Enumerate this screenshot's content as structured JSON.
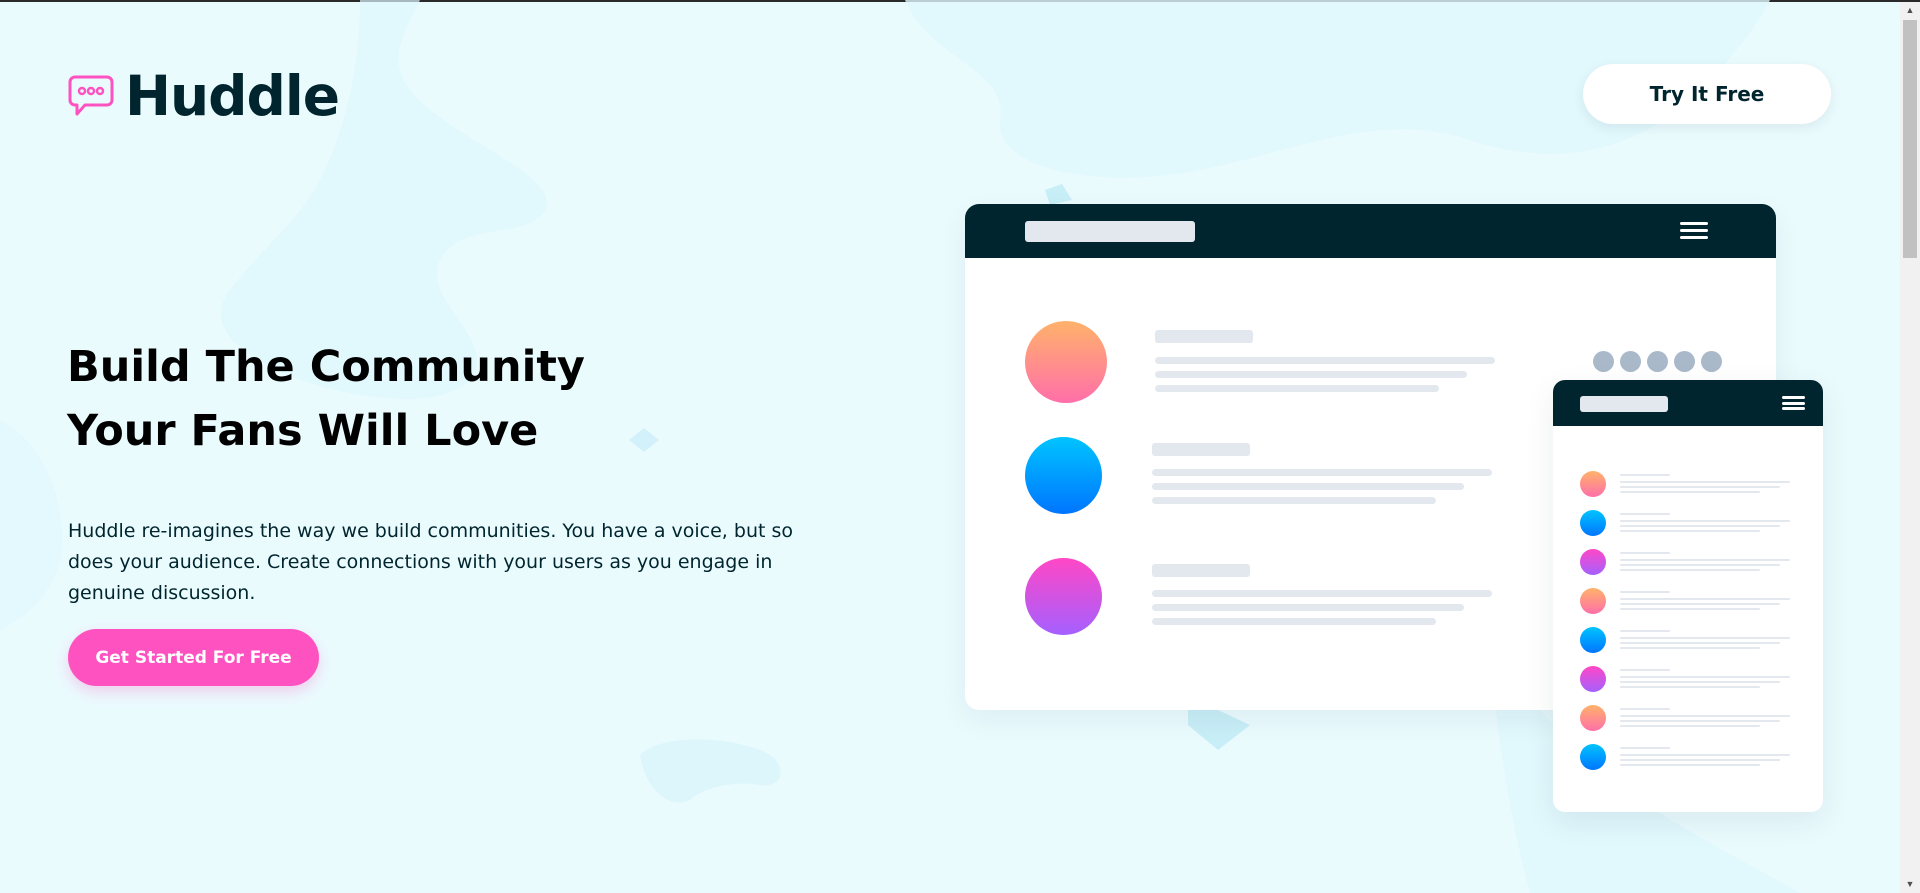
{
  "brand": {
    "name": "Huddle",
    "logo_icon": "chat-bubble-icon"
  },
  "header": {
    "cta_label": "Try It Free"
  },
  "hero": {
    "headline_lines": [
      "Build The Community",
      "Your Fans Will Love"
    ],
    "body_lines": [
      "Huddle re-imagines the way we build communities. You have a voice, but so",
      "does your audience. Create connections with your users as you engage in",
      "genuine discussion."
    ],
    "cta_label": "Get Started For Free"
  },
  "colors": {
    "background": "#eafbfe",
    "dark": "#00252e",
    "pink": "#ff52c1",
    "white": "#ffffff",
    "placeholder": "#e3e8ee",
    "dot": "#a9b9c9"
  },
  "mockup_icons": {
    "menu": "hamburger-menu-icon"
  }
}
